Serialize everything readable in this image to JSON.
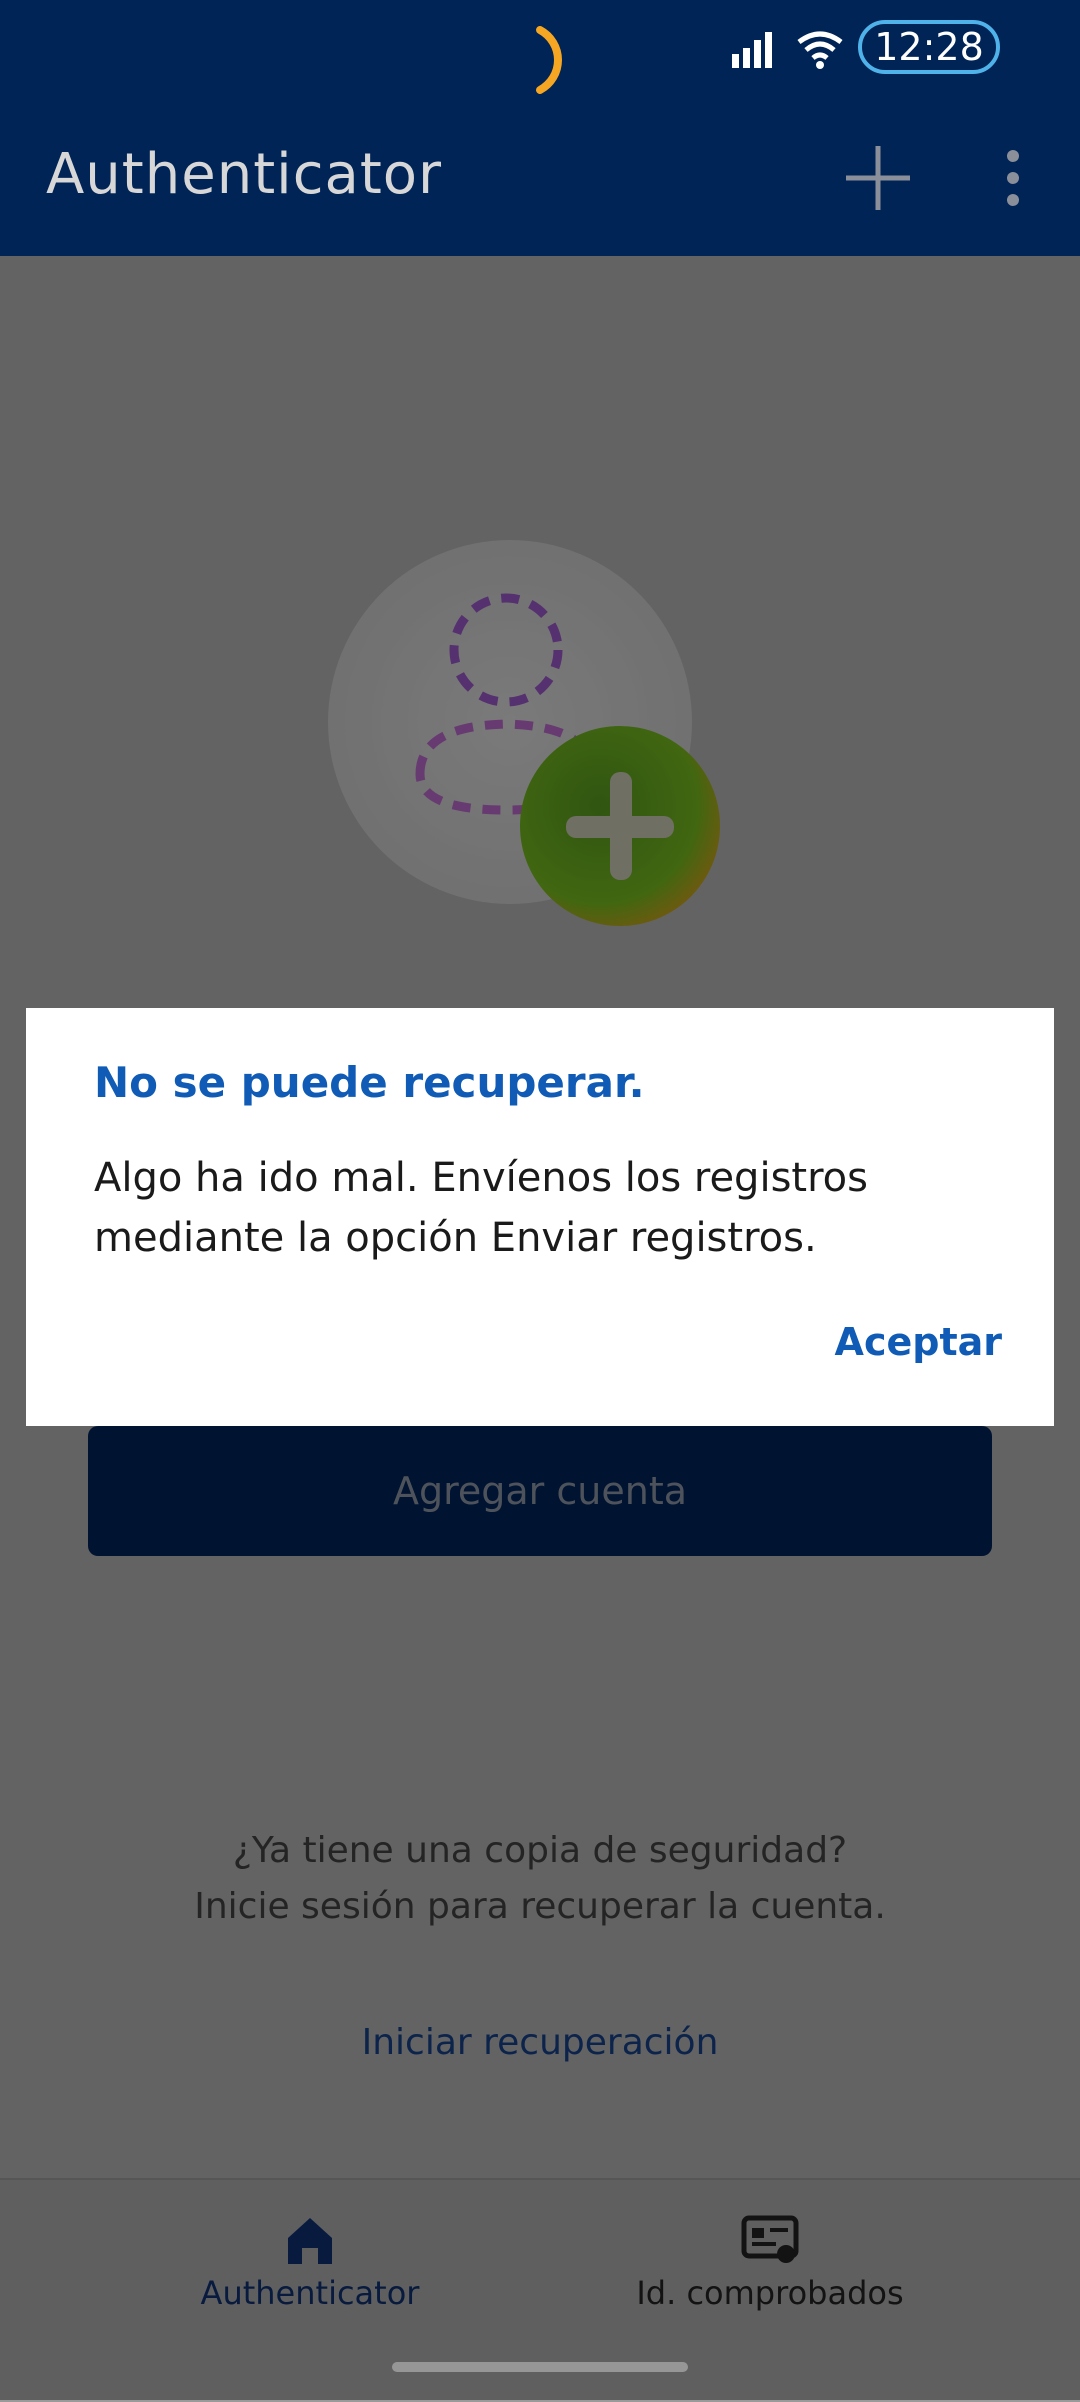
{
  "status_bar": {
    "time": "12:28"
  },
  "app_bar": {
    "title": "Authenticator"
  },
  "main": {
    "add_account_label": "Agregar cuenta",
    "backup_question": "¿Ya tiene una copia de seguridad?",
    "backup_hint": "Inicie sesión para recuperar la cuenta.",
    "recovery_link": "Iniciar recuperación"
  },
  "bottom_nav": {
    "items": [
      {
        "label": "Authenticator",
        "icon": "home-icon",
        "active": true
      },
      {
        "label": "Id. comprobados",
        "icon": "verified-id-icon",
        "active": false
      }
    ]
  },
  "dialog": {
    "title": "No se puede recuperar.",
    "message": "Algo ha ido mal. Envíenos los registros mediante la opción Enviar registros.",
    "ok_label": "Aceptar"
  },
  "colors": {
    "app_bar": "#012457",
    "accent": "#0f5bb5",
    "time_pill_border": "#4fb3ea"
  }
}
